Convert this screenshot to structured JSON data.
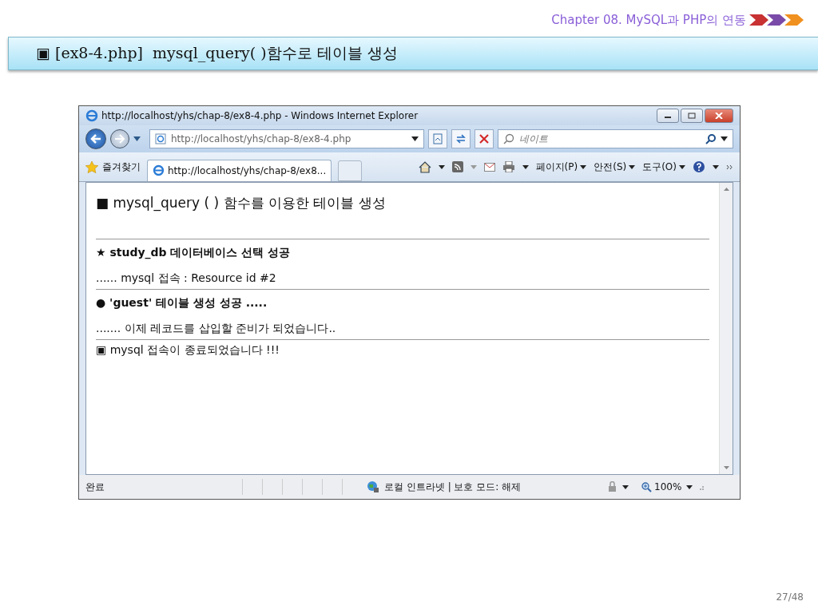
{
  "slide": {
    "chapter": "Chapter 08. MySQL과 PHP의 연동",
    "title": "▣ [ex8-4.php]  mysql_query( )함수로 테이블 생성",
    "page": "27/48"
  },
  "browser": {
    "title": "http://localhost/yhs/chap-8/ex8-4.php - Windows Internet Explorer",
    "address": "http://localhost/yhs/chap-8/ex8-4.php",
    "search": {
      "placeholder": "네이트"
    },
    "favorites": "즐겨찾기",
    "tab": "http://localhost/yhs/chap-8/ex8...",
    "menus": [
      "페이지(P)",
      "안전(S)",
      "도구(O)"
    ],
    "content": [
      {
        "kind": "heading",
        "text": "■ mysql_query ( ) 함수를 이용한 테이블 생성",
        "rule_below": true
      },
      {
        "kind": "bold",
        "text": "★ study_db 데이터베이스 선택 성공",
        "rule_below": false
      },
      {
        "kind": "plain",
        "text": "...... mysql 접속 : Resource id #2",
        "rule_below": true
      },
      {
        "kind": "bold",
        "text": "● 'guest' 테이블 생성 성공 .....",
        "rule_below": false
      },
      {
        "kind": "plain",
        "text": "....... 이제 레코드를 삽입할 준비가 되었습니다..",
        "rule_below": true
      },
      {
        "kind": "plain",
        "text": "▣ mysql 접속이 종료되었습니다 !!!",
        "rule_below": false
      }
    ],
    "status": {
      "text": "완료",
      "zone": "로컬 인트라넷 | 보호 모드: 해제",
      "zoom": "100%"
    }
  }
}
